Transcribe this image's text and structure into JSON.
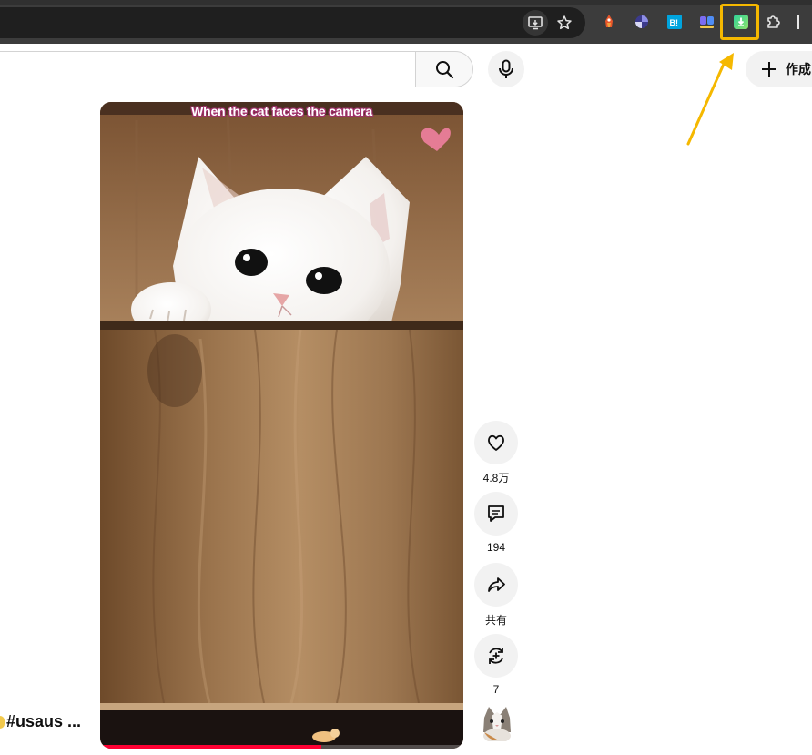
{
  "video": {
    "caption": "When the cat faces the camera",
    "progress": 0.61
  },
  "actions": {
    "like_count": "4.8万",
    "comment_count": "194",
    "share_label": "共有",
    "remix_count": "7"
  },
  "header": {
    "create_label": "作成"
  },
  "title": {
    "text": "#usaus ..."
  },
  "colors": {
    "chrome_bg": "#3c3c3c",
    "highlight": "#f5b800",
    "progress": "#ff0033"
  }
}
